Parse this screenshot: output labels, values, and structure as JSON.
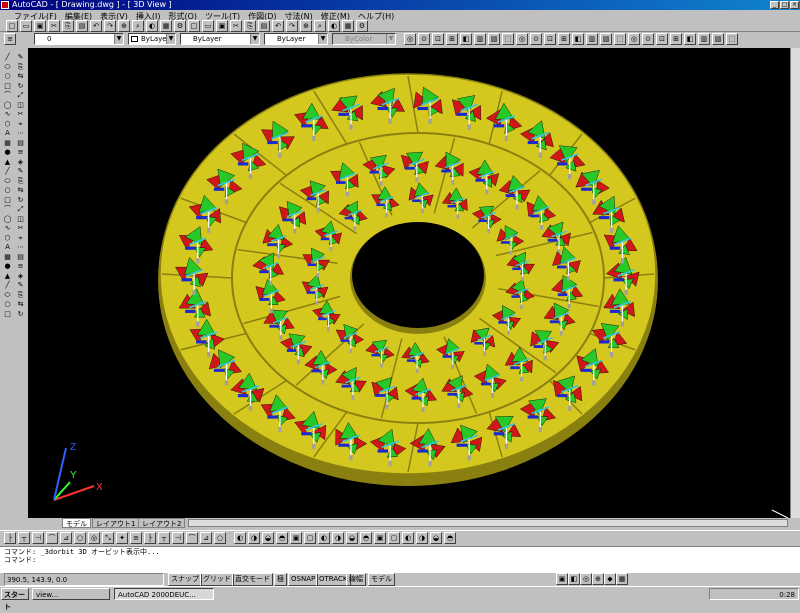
{
  "window": {
    "title": "AutoCAD - [ Drawing.dwg ] - [ 3D View ]",
    "min": "_",
    "max": "□",
    "close": "×"
  },
  "menu": {
    "items": [
      "ファイル(F)",
      "編集(E)",
      "表示(V)",
      "挿入(I)",
      "形式(O)",
      "ツール(T)",
      "作図(D)",
      "寸法(N)",
      "修正(M)",
      "ヘルプ(H)"
    ]
  },
  "properties": {
    "layer": "0",
    "color": "ByLayer",
    "linetype": "ByLayer",
    "lineweight": "ByLayer",
    "plotstyle": "ByColor"
  },
  "layout_tabs": [
    "モデル",
    "レイアウト1",
    "レイアウト2"
  ],
  "command_line": {
    "lines": [
      "コマンド: _3dorbit 3D オービット表示中...",
      "コマンド:"
    ]
  },
  "status": {
    "coords": "390.5, 143.9, 0.0",
    "toggles": [
      "スナップ",
      "グリッド",
      "直交モード",
      "極",
      "OSNAP",
      "OTRACK",
      "線幅",
      "モデル"
    ]
  },
  "taskbar": {
    "start": "スタート",
    "tasks": [
      "view...",
      "AutoCAD 2000DEUC..."
    ],
    "clock": "0:28"
  },
  "model": {
    "colors": {
      "background": "#000000",
      "disk": "#d4c81e",
      "red": "#d01818",
      "green": "#28c828",
      "blue": "#1a2ad0",
      "cyan": "#30c8e0",
      "gray": "#a0a0a0"
    }
  },
  "ucs_icon": {
    "x_label": "X",
    "y_label": "Y",
    "z_label": "Z"
  }
}
